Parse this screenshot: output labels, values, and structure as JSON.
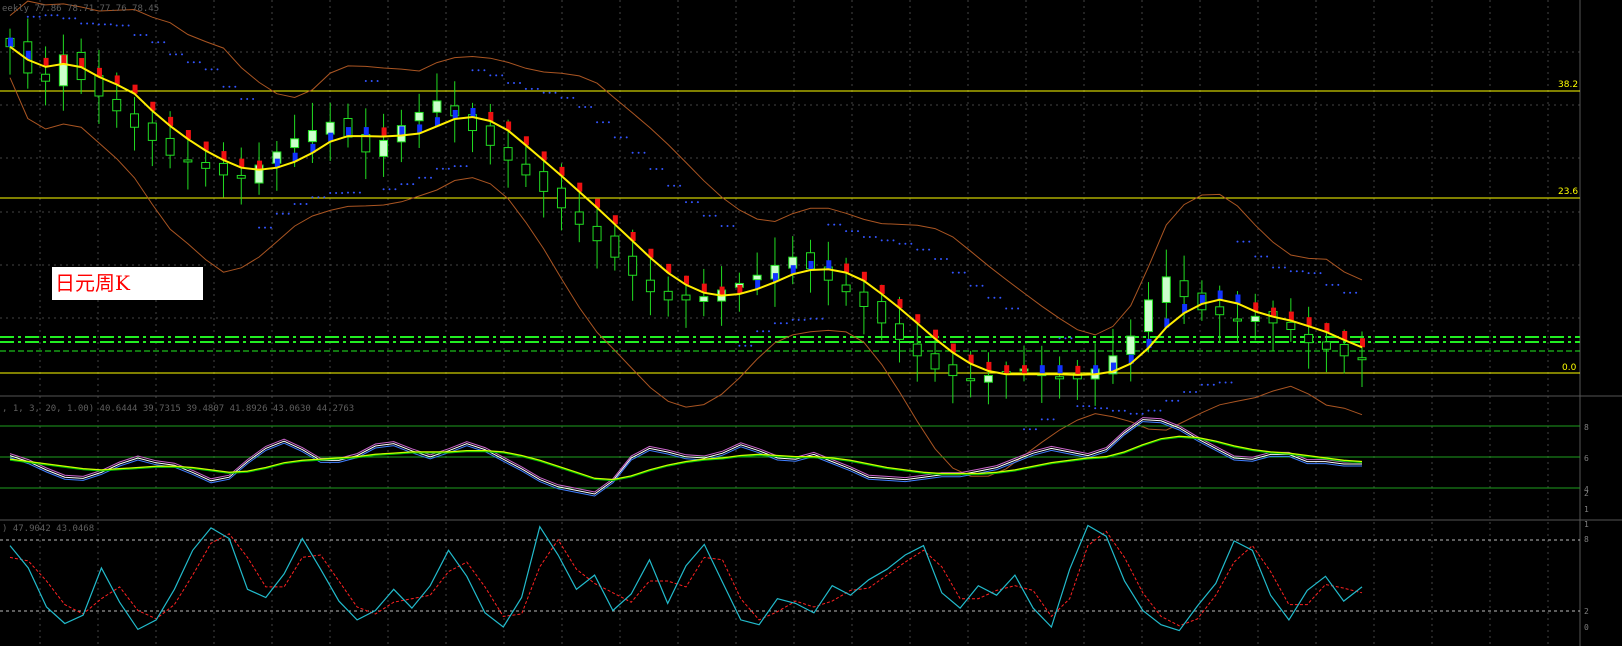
{
  "main": {
    "header_text": "eekly  77.86 78.71 77.76 78.45",
    "label": "日元周K",
    "fib_levels": [
      {
        "label": "38.2"
      },
      {
        "label": "23.6"
      },
      {
        "label": "0.0"
      }
    ],
    "colors": {
      "bull": "#ccffcc",
      "bull_wick": "#22dd22",
      "bear": "#ee1111",
      "bear_dim": "#ff3333",
      "blue": "#1133ff",
      "ma": "#ffee00",
      "bands": "#aa5522",
      "psar": "#3355ff",
      "fib": "#ffff00",
      "grid": "#444444",
      "dashed_green": "#22ee22"
    }
  },
  "stoch_panel": {
    "header_text": ", 1, 3, 20, 1.00) 40.6444 39.7315 39.4807 41.8926 43.0630 44.2763",
    "level_ticks": [
      "8",
      "6",
      "4",
      "2",
      "1"
    ]
  },
  "osc_panel": {
    "header_text": ") 47.9042 43.0468",
    "level_ticks": [
      "1",
      "8",
      "2",
      "0"
    ]
  },
  "chart_data": {
    "type": "line",
    "panels": [
      "price",
      "stochastic",
      "oscillator"
    ],
    "price": {
      "close": [
        82.0,
        80.4,
        79.9,
        81.5,
        80.0,
        79.0,
        78.1,
        77.1,
        76.3,
        75.4,
        75.0,
        74.6,
        74.2,
        74.0,
        74.8,
        75.6,
        76.4,
        76.9,
        77.4,
        76.5,
        75.6,
        76.3,
        77.2,
        78.0,
        78.7,
        77.8,
        76.9,
        76.0,
        75.1,
        74.2,
        73.2,
        72.2,
        71.2,
        70.2,
        69.2,
        68.1,
        67.1,
        66.6,
        66.6,
        66.8,
        67.2,
        67.6,
        68.1,
        68.7,
        69.2,
        68.5,
        67.8,
        67.1,
        66.2,
        65.2,
        64.2,
        63.2,
        62.4,
        62.0,
        61.8,
        62.0,
        62.2,
        62.4,
        62.0,
        61.8,
        61.8,
        62.4,
        63.2,
        64.4,
        66.6,
        68.0,
        66.8,
        66.0,
        65.7,
        65.4,
        65.6,
        65.2,
        64.8,
        64.0,
        63.6,
        63.2,
        63.0
      ]
    },
    "stochastic": {
      "main": [
        52,
        47,
        40,
        34,
        33,
        38,
        45,
        50,
        46,
        44,
        38,
        31,
        34,
        47,
        58,
        64,
        57,
        48,
        48,
        52,
        60,
        62,
        56,
        51,
        56,
        62,
        57,
        49,
        41,
        32,
        26,
        23,
        20,
        31,
        50,
        58,
        55,
        51,
        50,
        54,
        61,
        56,
        50,
        49,
        53,
        47,
        41,
        34,
        33,
        32,
        34,
        36,
        36,
        39,
        42,
        48,
        54,
        58,
        55,
        52,
        57,
        71,
        82,
        81,
        75,
        66,
        58,
        50,
        49,
        53,
        53,
        47,
        47,
        45,
        45
      ],
      "signal": [
        49,
        47,
        45,
        43,
        41,
        40,
        41,
        42,
        43,
        43,
        42,
        40,
        38,
        39,
        42,
        46,
        48,
        49,
        50,
        51,
        53,
        54,
        55,
        55,
        55,
        56,
        56,
        55,
        52,
        48,
        43,
        38,
        33,
        32,
        35,
        40,
        44,
        47,
        49,
        50,
        52,
        53,
        52,
        51,
        51,
        50,
        48,
        45,
        42,
        40,
        38,
        37,
        37,
        37,
        38,
        40,
        43,
        46,
        48,
        50,
        51,
        55,
        61,
        66,
        68,
        67,
        64,
        60,
        57,
        55,
        54,
        52,
        50,
        48,
        47
      ]
    },
    "oscillator": {
      "main": [
        80,
        61,
        28,
        14,
        21,
        61,
        32,
        9,
        17,
        43,
        76,
        95,
        86,
        43,
        36,
        56,
        86,
        60,
        33,
        17,
        25,
        43,
        27,
        46,
        76,
        54,
        23,
        11,
        36,
        96,
        72,
        43,
        55,
        25,
        39,
        68,
        31,
        63,
        81,
        49,
        17,
        13,
        35,
        31,
        23,
        46,
        38,
        51,
        60,
        72,
        80,
        40,
        27,
        46,
        38,
        55,
        27,
        11,
        60,
        97,
        88,
        50,
        25,
        13,
        8,
        29,
        48,
        84,
        76,
        38,
        17,
        42,
        54,
        33,
        45
      ],
      "signal": [
        70,
        67,
        50,
        30,
        22,
        35,
        45,
        25,
        18,
        30,
        55,
        82,
        90,
        70,
        45,
        45,
        70,
        72,
        50,
        28,
        22,
        32,
        35,
        38,
        58,
        66,
        45,
        20,
        22,
        62,
        85,
        60,
        48,
        40,
        32,
        50,
        50,
        45,
        70,
        68,
        35,
        17,
        24,
        33,
        28,
        33,
        42,
        44,
        55,
        66,
        76,
        62,
        35,
        35,
        42,
        46,
        42,
        20,
        35,
        80,
        92,
        70,
        40,
        20,
        12,
        18,
        38,
        66,
        80,
        58,
        30,
        30,
        47,
        44,
        40
      ]
    }
  }
}
